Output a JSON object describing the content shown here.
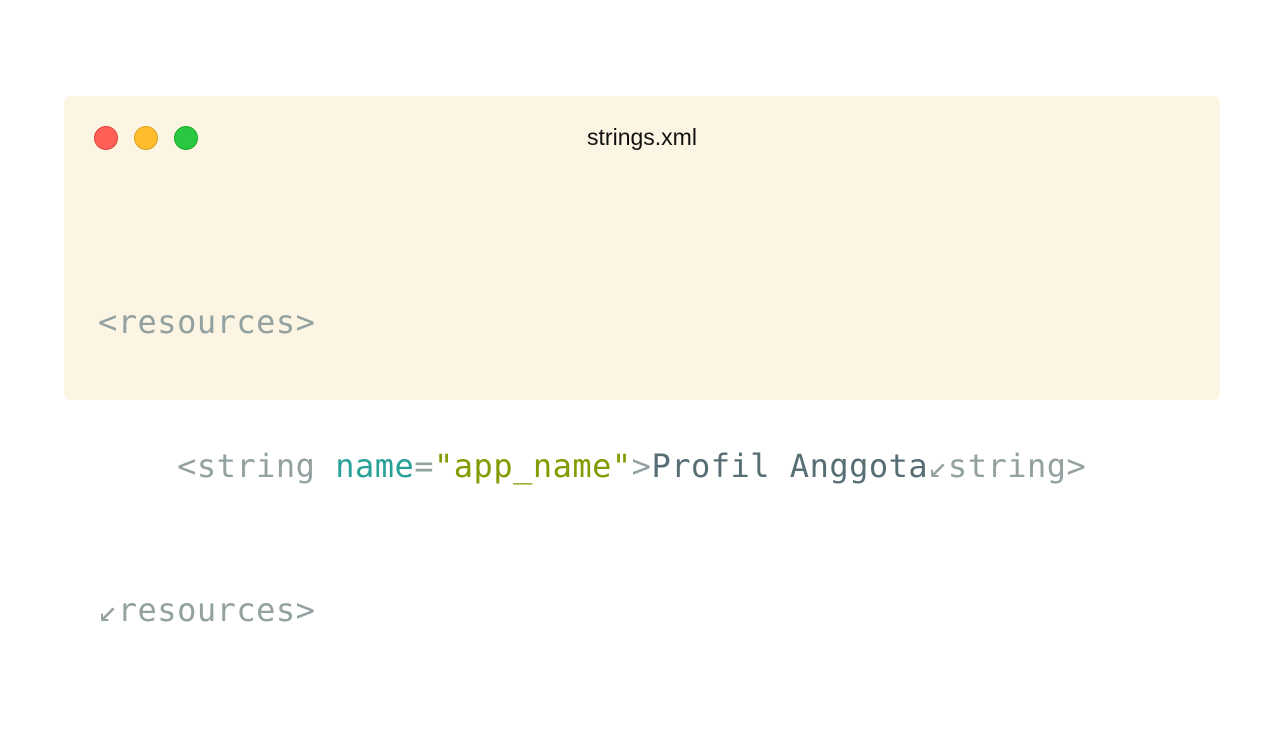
{
  "window": {
    "title": "strings.xml"
  },
  "code": {
    "line1": {
      "open_tag": "<resources>"
    },
    "line2": {
      "indent": "    ",
      "tag_open": "<string",
      "space": " ",
      "attr_name": "name",
      "equals": "=",
      "attr_value": "\"app_name\"",
      "tag_close": ">",
      "content": "Profil Anggota",
      "close_tag": "↙string>"
    },
    "line3": {
      "close_tag": "↙resources>"
    }
  },
  "colors": {
    "background": "#fcf5e3",
    "punctuation": "#93a1a1",
    "attribute": "#2aa198",
    "string": "#859900",
    "text": "#586e75"
  }
}
